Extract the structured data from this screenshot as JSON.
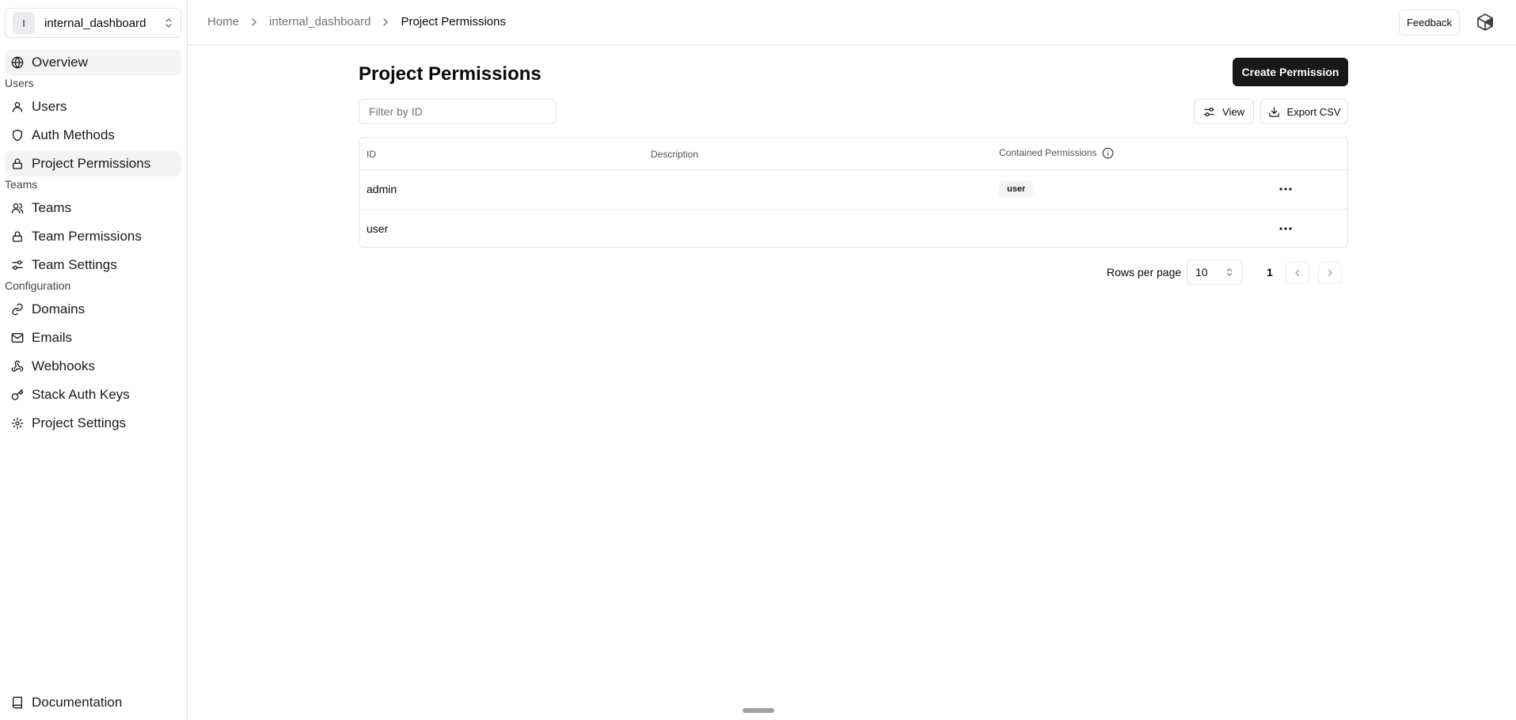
{
  "project": {
    "avatar_letter": "I",
    "name": "internal_dashboard"
  },
  "sidebar": {
    "overview": "Overview",
    "sections": {
      "users": "Users",
      "teams": "Teams",
      "configuration": "Configuration"
    },
    "items": {
      "users": "Users",
      "auth_methods": "Auth Methods",
      "project_permissions": "Project Permissions",
      "teams": "Teams",
      "team_permissions": "Team Permissions",
      "team_settings": "Team Settings",
      "domains": "Domains",
      "emails": "Emails",
      "webhooks": "Webhooks",
      "stack_auth_keys": "Stack Auth Keys",
      "project_settings": "Project Settings"
    },
    "documentation": "Documentation"
  },
  "header": {
    "breadcrumb": [
      "Home",
      "internal_dashboard",
      "Project Permissions"
    ],
    "feedback_label": "Feedback"
  },
  "main": {
    "title": "Project Permissions",
    "create_label": "Create Permission",
    "filter_placeholder": "Filter by ID",
    "view_label": "View",
    "export_label": "Export CSV",
    "columns": [
      "ID",
      "Description",
      "Contained Permissions"
    ],
    "rows": [
      {
        "id": "admin",
        "description": "",
        "contained": [
          "user"
        ]
      },
      {
        "id": "user",
        "description": "",
        "contained": []
      }
    ],
    "pagination": {
      "rows_per_page_label": "Rows per page",
      "rows_per_page_value": "10",
      "page": "1"
    }
  }
}
